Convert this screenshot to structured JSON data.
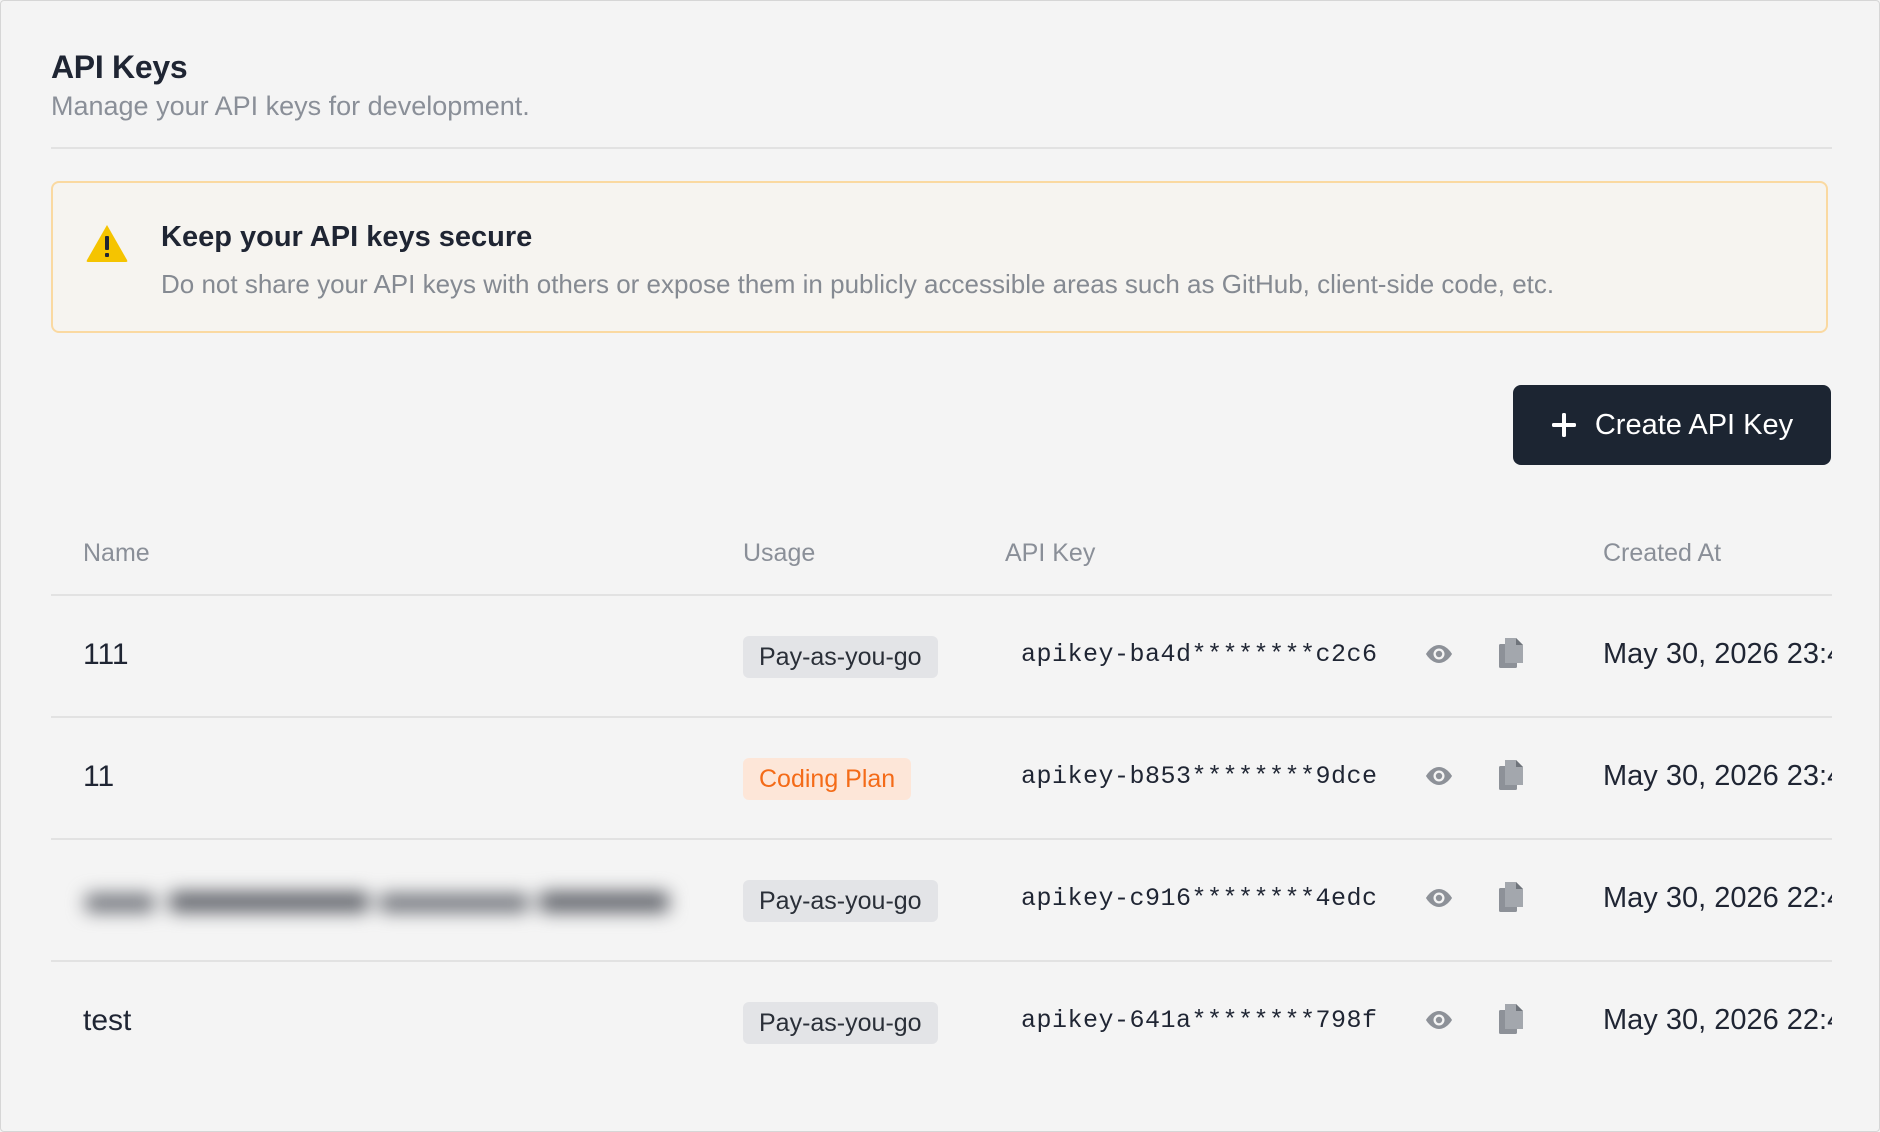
{
  "header": {
    "title": "API Keys",
    "subtitle": "Manage your API keys for development."
  },
  "alert": {
    "icon": "warning-icon",
    "title": "Keep your API keys secure",
    "text": "Do not share your API keys with others or expose them in publicly accessible areas such as GitHub, client-side code, etc."
  },
  "actions": {
    "create_label": "Create API Key",
    "create_icon": "plus-icon"
  },
  "table": {
    "columns": [
      "Name",
      "Usage",
      "API Key",
      "Created At"
    ],
    "rows": [
      {
        "name": "111",
        "usage": "Pay-as-you-go",
        "api_key": "apikey-ba4d********c2c6",
        "created_at": "May 30, 2026 23:4"
      },
      {
        "name": "11",
        "usage": "Coding Plan",
        "api_key": "apikey-b853********9dce",
        "created_at": "May 30, 2026 23:4"
      },
      {
        "name": "",
        "usage": "Pay-as-you-go",
        "api_key": "apikey-c916********4edc",
        "created_at": "May 30, 2026 22:4"
      },
      {
        "name": "test",
        "usage": "Pay-as-you-go",
        "api_key": "apikey-641a********798f",
        "created_at": "May 30, 2026 22:4"
      }
    ]
  },
  "colors": {
    "primary_button": "#1c2532",
    "alert_border": "#fad9a1",
    "warning_icon": "#f5c400",
    "coding_badge_bg": "#fde6d8",
    "coding_badge_text": "#f46b18",
    "payg_badge_bg": "#e3e4e7"
  }
}
